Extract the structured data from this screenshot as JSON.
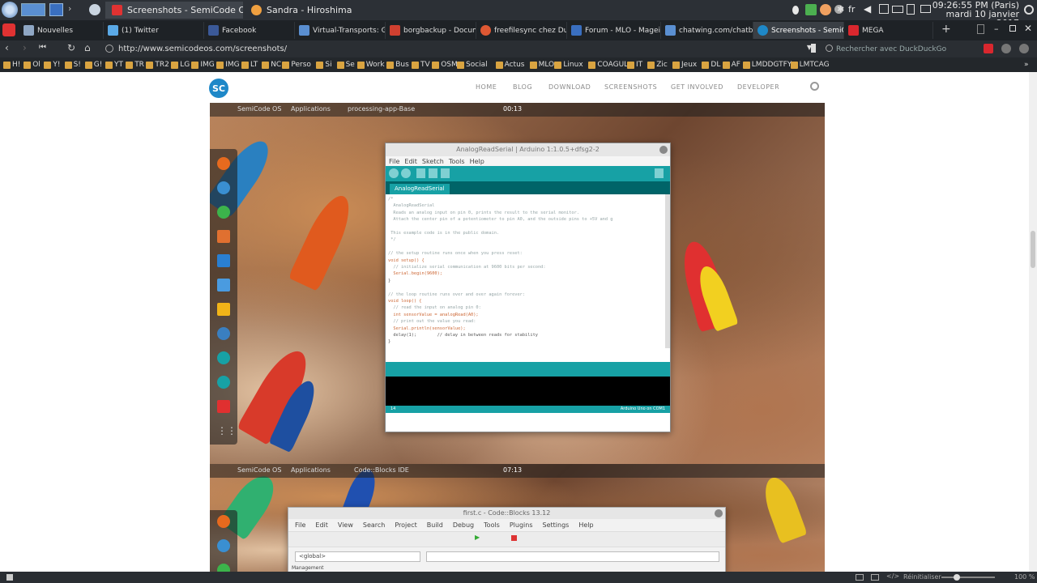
{
  "taskbar": {
    "windows": [
      {
        "label": "Screenshots - SemiCode OS",
        "active": true
      },
      {
        "label": "Sandra - Hiroshima",
        "active": false
      }
    ],
    "clock_time": "09:26:55 PM (Paris)",
    "clock_date": "mardi 10 janvier 2017",
    "lang": "fr"
  },
  "browser_tabs": [
    {
      "label": "Nouvelles"
    },
    {
      "label": "(1) Twitter"
    },
    {
      "label": "Facebook"
    },
    {
      "label": "Virtual-Transports: Gère"
    },
    {
      "label": "borgbackup - Document"
    },
    {
      "label": "freefilesync chez DuckD"
    },
    {
      "label": "Forum - MLO - Mageia L"
    },
    {
      "label": "chatwing.com/chatbox/7"
    },
    {
      "label": "Screenshots - SemiCod"
    },
    {
      "label": "MEGA"
    }
  ],
  "address": {
    "url": "http://www.semicodeos.com/screenshots/",
    "search_placeholder": "Rechercher avec DuckDuckGo"
  },
  "bookmarks": [
    "H!",
    "Ol",
    "Y!",
    "S!",
    "G!",
    "YT",
    "TR",
    "TR2",
    "LG",
    "IMG",
    "IMG",
    "LT",
    "NC",
    "Perso",
    "Si",
    "Se",
    "Work",
    "Bus",
    "TV",
    "OSM",
    "Social",
    "Actus",
    "MLO",
    "Linux",
    "COAGUL",
    "IT",
    "Zic",
    "Jeux",
    "DL",
    "AF",
    "LMDDGTFY",
    "LMTCAG"
  ],
  "site": {
    "logo": "SC",
    "nav": [
      "HOME",
      "BLOG",
      "DOWNLOAD",
      "SCREENSHOTS",
      "GET INVOLVED",
      "DEVELOPER"
    ]
  },
  "shot1": {
    "topbar_left": "SemiCode OS",
    "topbar_apps": "Applications",
    "topbar_task": "processing-app-Base",
    "topbar_time": "00:13",
    "arduino": {
      "title": "AnalogReadSerial | Arduino 1:1.0.5+dfsg2-2",
      "menu": [
        "File",
        "Edit",
        "Sketch",
        "Tools",
        "Help"
      ],
      "tab": "AnalogReadSerial",
      "code_lines": [
        "/*",
        "  AnalogReadSerial",
        "  Reads an analog input on pin 0, prints the result to the serial monitor.",
        "  Attach the center pin of a potentiometer to pin A0, and the outside pins to +5V and g",
        "",
        " This example code is in the public domain.",
        " */",
        "",
        "// the setup routine runs once when you press reset:",
        "void setup() {",
        "  // initialize serial communication at 9600 bits per second:",
        "  Serial.begin(9600);",
        "}",
        "",
        "// the loop routine runs over and over again forever:",
        "void loop() {",
        "  // read the input on analog pin 0:",
        "  int sensorValue = analogRead(A0);",
        "  // print out the value you read:",
        "  Serial.println(sensorValue);",
        "  delay(1);        // delay in between reads for stability",
        "}"
      ],
      "status_line": "14",
      "status_board": "Arduino Uno on COM1"
    }
  },
  "shot2": {
    "topbar_left": "SemiCode OS",
    "topbar_apps": "Applications",
    "topbar_task": "Code::Blocks IDE",
    "topbar_time": "07:13",
    "codeblocks": {
      "title": "first.c - Code::Blocks 13.12",
      "menu": [
        "File",
        "Edit",
        "View",
        "Search",
        "Project",
        "Build",
        "Debug",
        "Tools",
        "Plugins",
        "Settings",
        "Help"
      ],
      "scope": "<global>",
      "panel": "Management"
    }
  },
  "statusbar": {
    "reset": "Réinitialiser",
    "zoom": "100 %"
  }
}
